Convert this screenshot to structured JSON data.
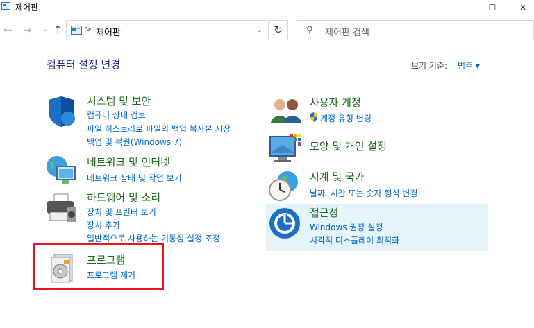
{
  "window": {
    "title": "제어판",
    "controls": {
      "minimize": "—",
      "maximize": "☐",
      "close": "✕"
    }
  },
  "address": {
    "path": "제어판",
    "back": "←",
    "forward": "→",
    "history": "⌄",
    "up": "↑",
    "refresh": "↻",
    "search_placeholder": "제어판 검색"
  },
  "header": {
    "title": "컴퓨터 설정 변경",
    "view_by_label": "보기 기준:",
    "view_by_value": "범주 ▾"
  },
  "categories": [
    {
      "title": "시스템 및 보안",
      "links": [
        "컴퓨터 상태 검토",
        "파일 히스토리로 파일의 백업 복사본 저장",
        "백업 및 복원(Windows 7)"
      ]
    },
    {
      "title": "네트워크 및 인터넷",
      "links": [
        "네트워크 상태 및 작업 보기"
      ]
    },
    {
      "title": "하드웨어 및 소리",
      "links": [
        "장치 및 프린터 보기",
        "장치 추가",
        "일반적으로 사용하는 기동성 설정 조정"
      ]
    },
    {
      "title": "프로그램",
      "links": [
        "프로그램 제거"
      ]
    },
    {
      "title": "사용자 계정",
      "links": [
        "계정 유형 변경"
      ]
    },
    {
      "title": "모양 및 개인 설정",
      "links": []
    },
    {
      "title": "시계 및 국가",
      "links": [
        "날짜, 시간 또는 숫자 형식 변경"
      ]
    },
    {
      "title": "접근성",
      "links": [
        "Windows 권장 설정",
        "시각적 디스플레이 최적화"
      ]
    }
  ],
  "colors": {
    "category_title": "#1e6b1e",
    "link": "#0066cc",
    "page_title": "#1e3287",
    "hover_highlight": "#e5f3fb",
    "annotation_box": "#e8141b"
  }
}
